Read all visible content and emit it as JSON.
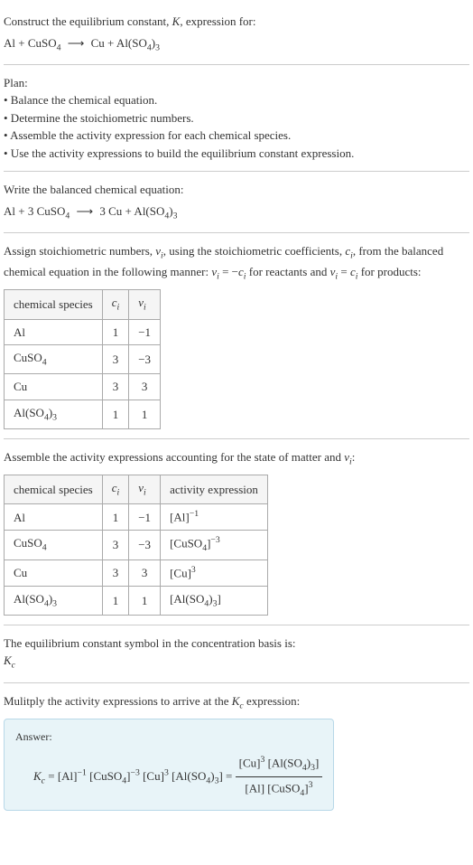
{
  "intro": {
    "line1": "Construct the equilibrium constant, ",
    "line1_K": "K",
    "line1b": ", expression for:",
    "eq_lhs": "Al + CuSO",
    "eq_sub1": "4",
    "eq_arrow": "⟶",
    "eq_rhs": "Cu + Al(SO",
    "eq_sub2": "4",
    "eq_rhs2": ")",
    "eq_sub3": "3"
  },
  "plan": {
    "heading": "Plan:",
    "b1": "• Balance the chemical equation.",
    "b2": "• Determine the stoichiometric numbers.",
    "b3": "• Assemble the activity expression for each chemical species.",
    "b4": "• Use the activity expressions to build the equilibrium constant expression."
  },
  "balanced": {
    "heading": "Write the balanced chemical equation:",
    "lhs": "Al + 3 CuSO",
    "sub1": "4",
    "arrow": "⟶",
    "rhs1": "3 Cu + Al(SO",
    "sub2": "4",
    "rhs2": ")",
    "sub3": "3"
  },
  "stoich": {
    "text1": "Assign stoichiometric numbers, ",
    "nu": "ν",
    "sub_i": "i",
    "text2": ", using the stoichiometric coefficients, ",
    "c": "c",
    "text3": ", from the balanced chemical equation in the following manner: ",
    "eq1a": "ν",
    "eq1b": " = −",
    "eq1c": "c",
    "text4": " for reactants and ",
    "eq2a": "ν",
    "eq2b": " = ",
    "eq2c": "c",
    "text5": " for products:",
    "table": {
      "h1": "chemical species",
      "h2": "c",
      "h3": "ν",
      "rows": [
        {
          "sp": "Al",
          "c": "1",
          "nu": "−1"
        },
        {
          "sp": "CuSO",
          "sp_sub": "4",
          "c": "3",
          "nu": "−3"
        },
        {
          "sp": "Cu",
          "c": "3",
          "nu": "3"
        },
        {
          "sp": "Al(SO",
          "sp_sub": "4",
          "sp_tail": ")",
          "sp_sub2": "3",
          "c": "1",
          "nu": "1"
        }
      ]
    }
  },
  "activity": {
    "heading": "Assemble the activity expressions accounting for the state of matter and ",
    "nu": "ν",
    "sub_i": "i",
    "colon": ":",
    "table": {
      "h1": "chemical species",
      "h2": "c",
      "h3": "ν",
      "h4": "activity expression",
      "rows": [
        {
          "sp": "Al",
          "c": "1",
          "nu": "−1",
          "ae_base": "[Al]",
          "ae_exp": "−1"
        },
        {
          "sp": "CuSO",
          "sp_sub": "4",
          "c": "3",
          "nu": "−3",
          "ae_base": "[CuSO",
          "ae_sub": "4",
          "ae_tail": "]",
          "ae_exp": "−3"
        },
        {
          "sp": "Cu",
          "c": "3",
          "nu": "3",
          "ae_base": "[Cu]",
          "ae_exp": "3"
        },
        {
          "sp": "Al(SO",
          "sp_sub": "4",
          "sp_tail": ")",
          "sp_sub2": "3",
          "c": "1",
          "nu": "1",
          "ae_base": "[Al(SO",
          "ae_sub": "4",
          "ae_tail": ")",
          "ae_sub2": "3",
          "ae_tail2": "]"
        }
      ]
    }
  },
  "kc_symbol": {
    "heading": "The equilibrium constant symbol in the concentration basis is:",
    "K": "K",
    "sub_c": "c"
  },
  "multiply": {
    "heading1": "Mulitply the activity expressions to arrive at the ",
    "K": "K",
    "sub_c": "c",
    "heading2": " expression:"
  },
  "answer": {
    "label": "Answer:",
    "K": "K",
    "sub_c": "c",
    "eq": " = [Al]",
    "exp1": "−1",
    "t2": " [CuSO",
    "sub4a": "4",
    "t3": "]",
    "exp2": "−3",
    "t4": " [Cu]",
    "exp3": "3",
    "t5": " [Al(SO",
    "sub4b": "4",
    "t6": ")",
    "sub3a": "3",
    "t7": "] = ",
    "num1": "[Cu]",
    "num_exp": "3",
    "num2": " [Al(SO",
    "num_sub4": "4",
    "num3": ")",
    "num_sub3": "3",
    "num4": "]",
    "den1": "[Al] [CuSO",
    "den_sub4": "4",
    "den2": "]",
    "den_exp": "3"
  }
}
